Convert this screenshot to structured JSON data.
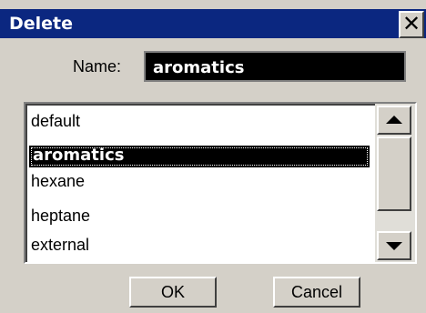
{
  "window": {
    "title": "Delete",
    "close_glyph": "✕"
  },
  "name_field": {
    "label": "Name:",
    "value": "aromatics"
  },
  "list": {
    "items": [
      "default",
      "aromatics",
      "hexane",
      "heptane",
      "external"
    ],
    "selected_index": 1
  },
  "buttons": {
    "ok": "OK",
    "cancel": "Cancel"
  },
  "colors": {
    "titlebar": "#0b2780",
    "face": "#d4d0c8",
    "selection": "#000000"
  }
}
